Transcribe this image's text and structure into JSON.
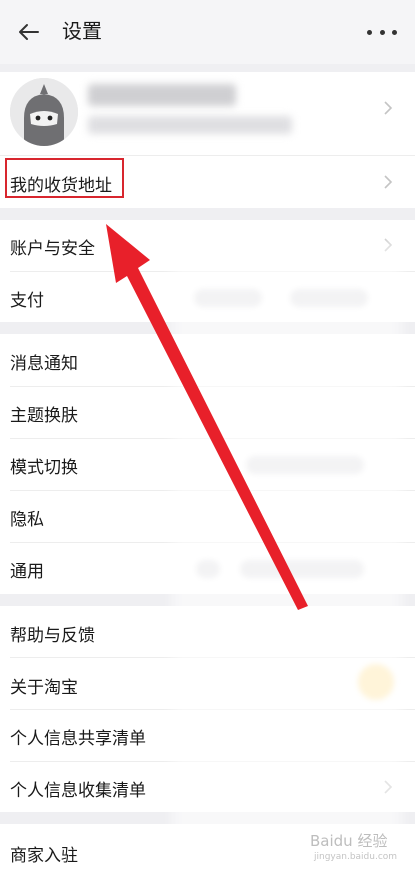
{
  "header": {
    "title": "设置",
    "back_icon": "arrow-left-icon",
    "more_icon": "more-dots-icon"
  },
  "profile": {
    "avatar_icon": "avatar-icon",
    "chevron_icon": "chevron-right-icon"
  },
  "address": {
    "label": "我的收货地址",
    "highlight_color": "#d8262e"
  },
  "group1": {
    "items": [
      {
        "label": "账户与安全"
      },
      {
        "label": "支付"
      }
    ]
  },
  "group2": {
    "items": [
      {
        "label": "消息通知"
      },
      {
        "label": "主题换肤"
      },
      {
        "label": "模式切换"
      },
      {
        "label": "隐私"
      },
      {
        "label": "通用"
      }
    ]
  },
  "group3": {
    "items": [
      {
        "label": "帮助与反馈"
      },
      {
        "label": "关于淘宝"
      },
      {
        "label": "个人信息共享清单"
      },
      {
        "label": "个人信息收集清单"
      }
    ]
  },
  "group4": {
    "items": [
      {
        "label": "商家入驻"
      }
    ]
  },
  "annotation": {
    "arrow_color": "#e8202a"
  },
  "watermark": {
    "text": "Baidu 经验",
    "sub": "jingyan.baidu.com"
  }
}
